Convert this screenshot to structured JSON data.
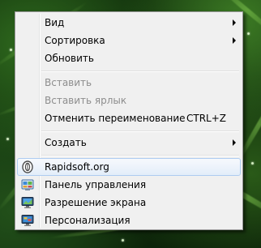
{
  "menu": {
    "items": [
      {
        "label": "Вид"
      },
      {
        "label": "Сортировка"
      },
      {
        "label": "Обновить"
      },
      {
        "label": "Вставить"
      },
      {
        "label": "Вставить ярлык"
      },
      {
        "label": "Отменить переименование",
        "shortcut": "CTRL+Z"
      },
      {
        "label": "Создать"
      },
      {
        "label": "Rapidsoft.org"
      },
      {
        "label": "Панель управления"
      },
      {
        "label": "Разрешение экрана"
      },
      {
        "label": "Персонализация"
      }
    ]
  },
  "icons": {
    "rapidsoft": "rapidsoft-logo-icon",
    "control_panel": "control-panel-icon",
    "screen_resolution": "monitor-icon",
    "personalization": "personalization-icon"
  },
  "colors": {
    "menu_bg": "#f0f0f0",
    "hover_border": "#aeccf1",
    "disabled_text": "#8d8d8d"
  }
}
